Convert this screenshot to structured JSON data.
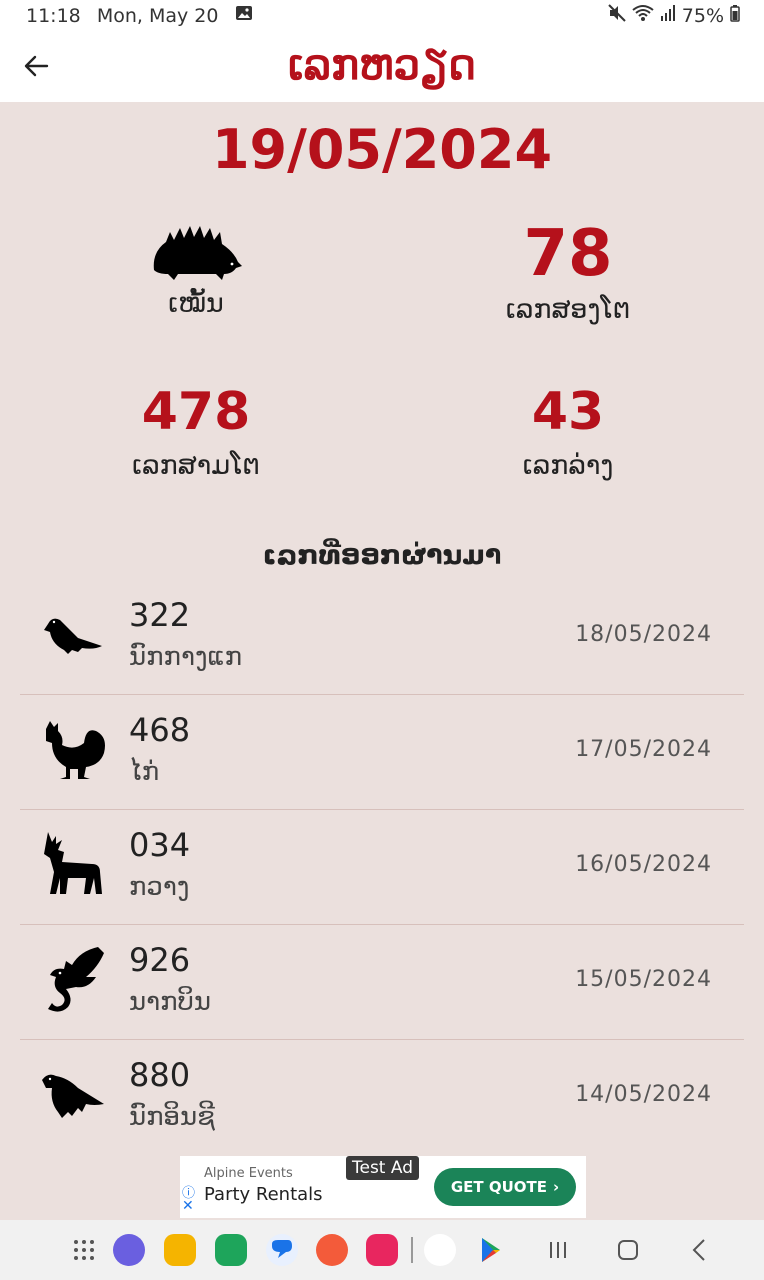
{
  "status_bar": {
    "time": "11:18",
    "date": "Mon, May 20",
    "battery": "75%"
  },
  "app_bar": {
    "title": "ເລກຫວຽດ"
  },
  "result": {
    "date": "19/05/2024",
    "animal_name": "ເໝັ້ນ",
    "animal_icon": "hedgehog-icon",
    "two_digit": {
      "value": "78",
      "label": "ເລກສອງໂຕ"
    },
    "three_digit": {
      "value": "478",
      "label": "ເລກສາມໂຕ"
    },
    "lower": {
      "value": "43",
      "label": "ເລກລ່າງ"
    }
  },
  "history": {
    "title": "ເລກທີ່ອອກຜ່ານມາ",
    "items": [
      {
        "number": "322",
        "name": "ນົກກາງແກ",
        "date": "18/05/2024",
        "icon": "pigeon-icon"
      },
      {
        "number": "468",
        "name": "ໄກ່",
        "date": "17/05/2024",
        "icon": "rooster-icon"
      },
      {
        "number": "034",
        "name": "ກວາງ",
        "date": "16/05/2024",
        "icon": "deer-icon"
      },
      {
        "number": "926",
        "name": "ນາກບິນ",
        "date": "15/05/2024",
        "icon": "dragon-icon"
      },
      {
        "number": "880",
        "name": "ນົກອິນຊີ",
        "date": "14/05/2024",
        "icon": "eagle-icon"
      }
    ]
  },
  "ad": {
    "brand": "Alpine Events",
    "headline": "Party Rentals",
    "badge": "Test Ad",
    "cta": "GET QUOTE"
  },
  "colors": {
    "accent": "#b5111b",
    "background": "#ebe0dd",
    "cta_green": "#1b8458"
  }
}
